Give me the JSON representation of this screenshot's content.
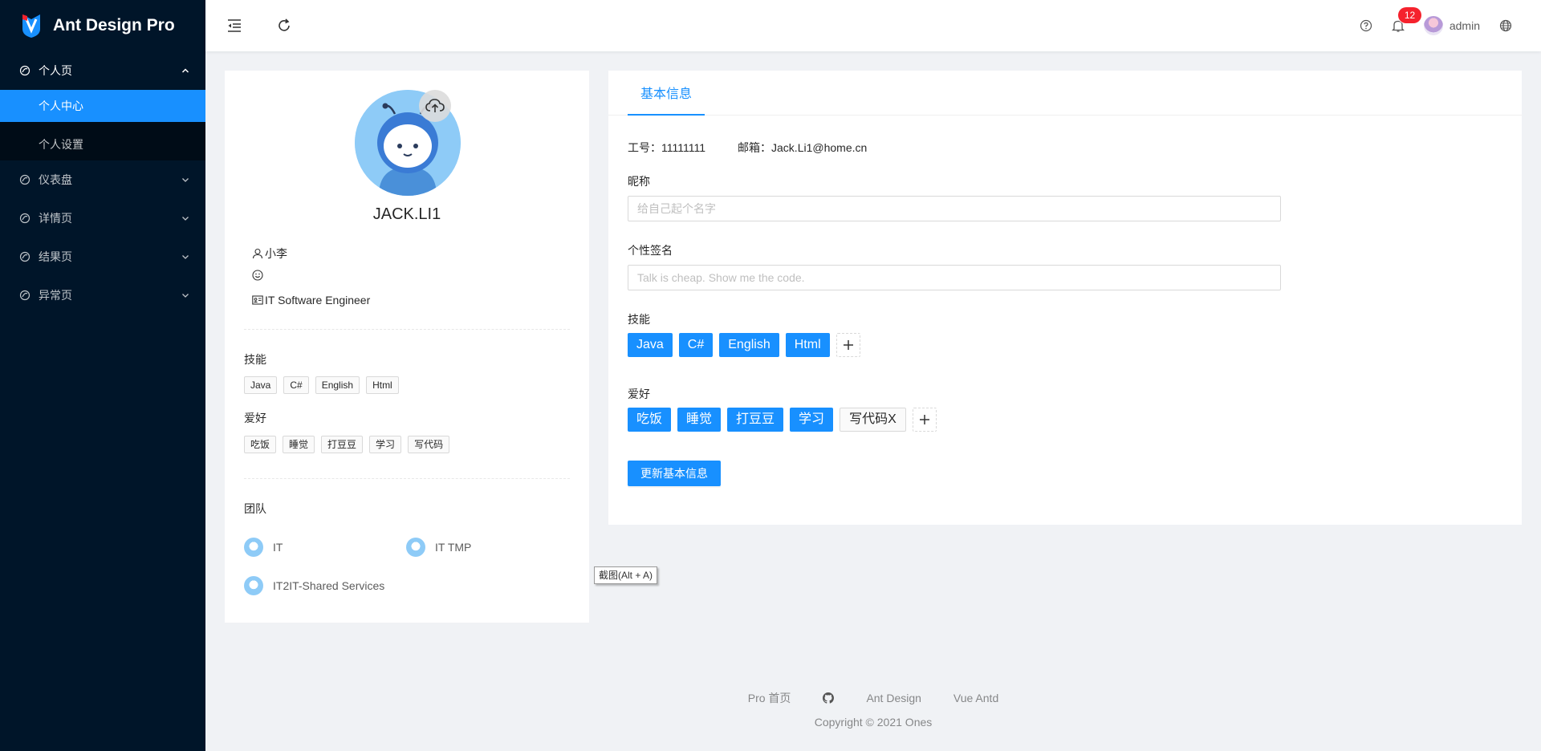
{
  "app": {
    "title": "Ant Design Pro"
  },
  "sidebar": {
    "menu": [
      {
        "label": "个人页",
        "icon": "menu-icon",
        "open": true,
        "children": [
          {
            "label": "个人中心",
            "active": true
          },
          {
            "label": "个人设置",
            "active": false
          }
        ]
      },
      {
        "label": "仪表盘",
        "icon": "menu-icon",
        "open": false
      },
      {
        "label": "详情页",
        "icon": "menu-icon",
        "open": false
      },
      {
        "label": "结果页",
        "icon": "menu-icon",
        "open": false
      },
      {
        "label": "异常页",
        "icon": "menu-icon",
        "open": false
      }
    ]
  },
  "header": {
    "notification_count": "12",
    "user_name": "admin"
  },
  "profile": {
    "name": "JACK.LI1",
    "nickname": "小李",
    "title": "IT Software Engineer",
    "skills_title": "技能",
    "skills": [
      "Java",
      "C#",
      "English",
      "Html"
    ],
    "hobbies_title": "爱好",
    "hobbies": [
      "吃饭",
      "睡觉",
      "打豆豆",
      "学习",
      "写代码"
    ],
    "team_title": "团队",
    "teams": [
      "IT",
      "IT TMP",
      "IT2IT-Shared Services"
    ]
  },
  "basic_info": {
    "tab_label": "基本信息",
    "employee_id": "工号：11111111",
    "email": "邮箱：Jack.Li1@home.cn",
    "nickname_label": "昵称",
    "nickname_placeholder": "给自己起个名字",
    "signature_label": "个性签名",
    "signature_placeholder": "Talk is cheap. Show me the code.",
    "skills_label": "技能",
    "skills": [
      "Java",
      "C#",
      "English",
      "Html"
    ],
    "hobbies_label": "爱好",
    "hobbies": [
      "吃饭",
      "睡觉",
      "打豆豆",
      "学习"
    ],
    "hobby_editing": "写代码X",
    "submit_label": "更新基本信息"
  },
  "tooltip": "截图(Alt + A)",
  "footer": {
    "links": [
      "Pro 首页",
      "Ant Design",
      "Vue Antd"
    ],
    "copyright_prefix": "Copyright",
    "copyright_suffix": "2021 Ones"
  },
  "colors": {
    "primary": "#1890ff",
    "sider": "#001529",
    "badge": "#f5222d"
  }
}
